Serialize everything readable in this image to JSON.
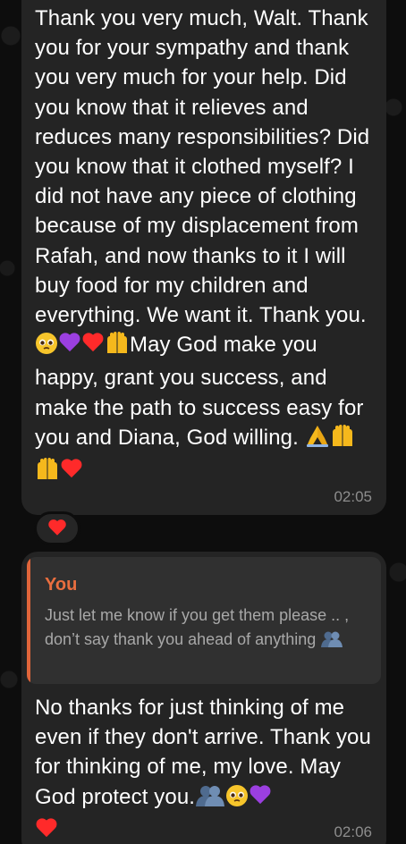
{
  "messages": [
    {
      "text_parts": [
        "Thank you very much, Walt. Thank you for your sympathy and thank you very much for your help. Did you know that it relieves and reduces many responsibilities? Did you know that it clothed myself? I did not have any piece of clothing because of my displacement from Rafah, and now thanks to it I will buy food for my children and everything. We want it. Thank you.",
        "May God make you happy, grant you success, and make the path to success easy for you and Diana, God willing."
      ],
      "emoji_group_1": [
        "pleading-face-icon",
        "purple-heart-icon",
        "red-heart-icon",
        "raising-hands-icon"
      ],
      "emoji_group_2": [
        "folded-hands-icon",
        "raising-hands-icon",
        "raising-hands-icon",
        "red-heart-icon"
      ],
      "time": "02:05",
      "reaction": "red-heart-icon"
    },
    {
      "reply": {
        "author": "You",
        "text": "Just let me know if you get them please .. , don’t say thank you ahead of anything"
      },
      "text": "No thanks for just thinking of me even if they don't arrive. Thank you for thinking of me, my love. May God protect you.",
      "emojis": [
        "people-hugging-icon",
        "pleading-face-icon",
        "purple-heart-icon",
        "red-heart-icon"
      ],
      "time": "02:06"
    }
  ],
  "colors": {
    "bubble": "#242424",
    "quote_bg": "#303030",
    "quote_accent": "#e0653a",
    "time": "#8d8d8d"
  }
}
